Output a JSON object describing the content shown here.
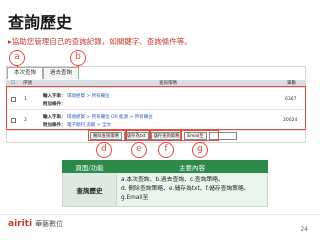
{
  "title": "查詢歷史",
  "subtitle": "▸協助您管理自己的查詢記錄，如關鍵字、查詢條件等。",
  "callouts": [
    "a",
    "b",
    "c",
    "d",
    "e",
    "f",
    "g"
  ],
  "tabs": [
    "本次查詢",
    "過去查詢"
  ],
  "table": {
    "headers": {
      "check": "☐",
      "num": "序號",
      "content": "查詢策略",
      "count": "筆數"
    },
    "rows": [
      {
        "num": "1",
        "line1_label": "輸入字串：",
        "line1_value": "環境經貿 > 所有欄位",
        "line2_label": "附加條件：",
        "count": "6307"
      },
      {
        "num": "2",
        "line1_label": "輸入字串：",
        "line1_value": "環境經貿 > 所有欄位 OR 能源 > 所有欄位",
        "line2_label": "附加條件：",
        "line2_value": "電子期刊 追蹤 > 全文",
        "count": "20024"
      }
    ]
  },
  "buttons": [
    "刪除查詢策略",
    "儲存為txt",
    "儲存查詢策略",
    "Email至"
  ],
  "email_placeholder": "",
  "feature_table": {
    "headers": [
      "頁面/功能",
      "主要內容"
    ],
    "row_key": "查詢歷史",
    "row_value_1": "a.本次查詢、b.過去查詢、c.查詢策略、",
    "row_value_2": "d. 刪除查詢策略、e.儲存為txt、f.儲存查詢策略、g.Email至"
  },
  "logo_mark": "airiti",
  "logo_text": "華藝數位",
  "page_number": "24",
  "colors": {
    "accent_red": "#e74c3c",
    "table_header_green": "#2b8a4a"
  }
}
